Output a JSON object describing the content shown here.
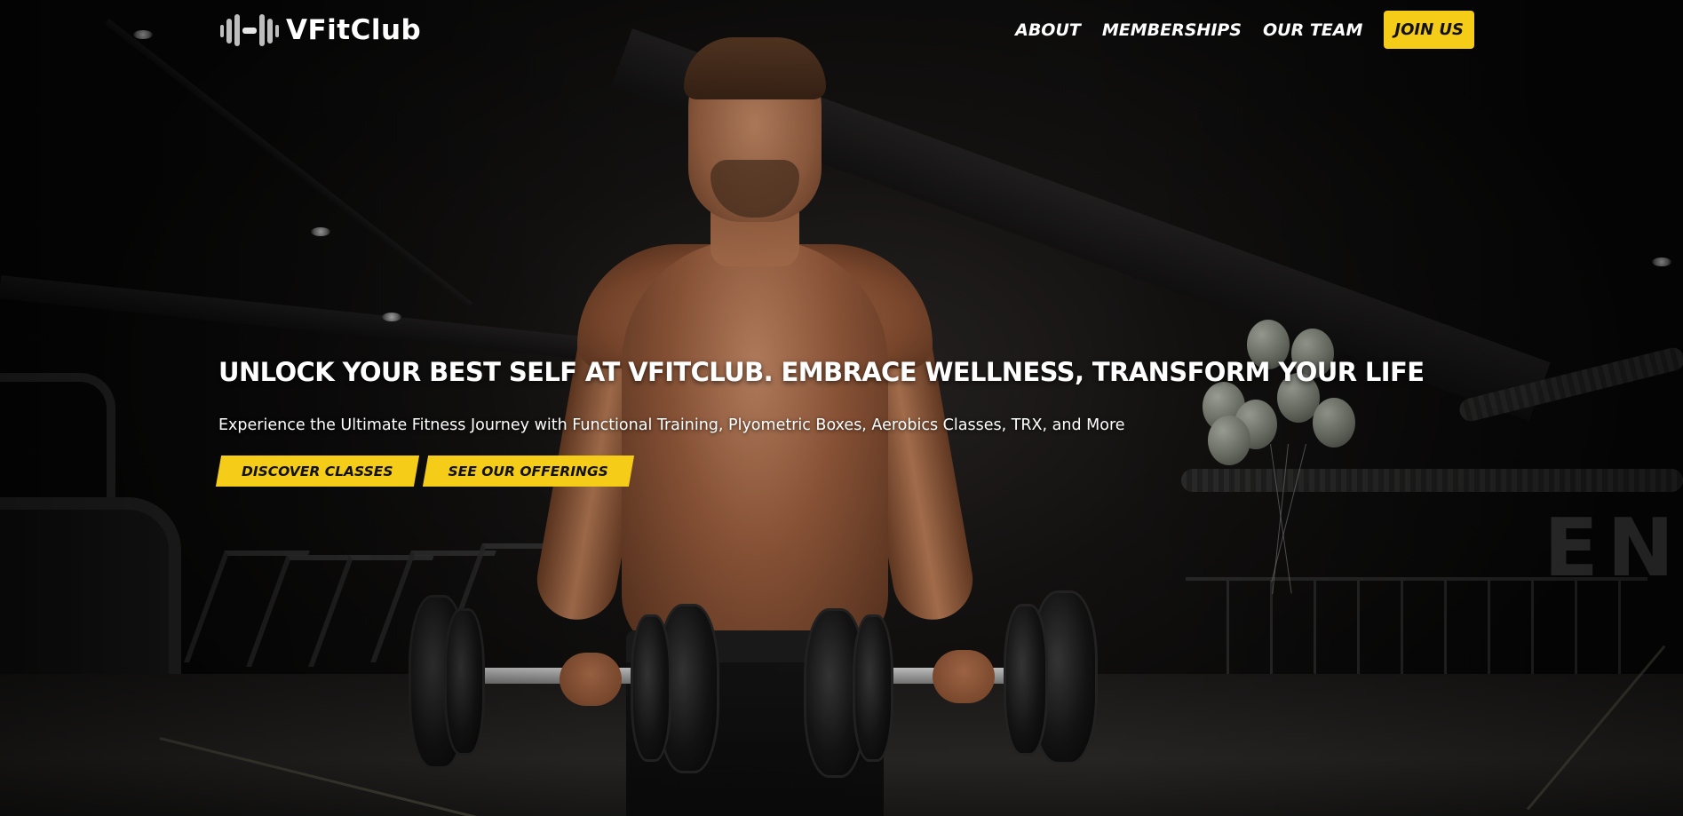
{
  "brand": {
    "logo_text": "VFitClub",
    "logo_icon": "dumbbell-icon",
    "accent_color": "#f5cc17"
  },
  "nav": {
    "links": [
      {
        "label": "ABOUT"
      },
      {
        "label": "MEMBERSHIPS"
      },
      {
        "label": "OUR TEAM"
      }
    ],
    "cta_label": "JOIN US"
  },
  "hero": {
    "title": "UNLOCK YOUR BEST SELF AT VFITCLUB. EMBRACE WELLNESS, TRANSFORM YOUR LIFE",
    "subtitle": "Experience the Ultimate Fitness Journey with Functional Training, Plyometric Boxes, Aerobics Classes, TRX, and More",
    "buttons": [
      {
        "label": "DISCOVER CLASSES"
      },
      {
        "label": "SEE OUR OFFERINGS"
      }
    ]
  }
}
